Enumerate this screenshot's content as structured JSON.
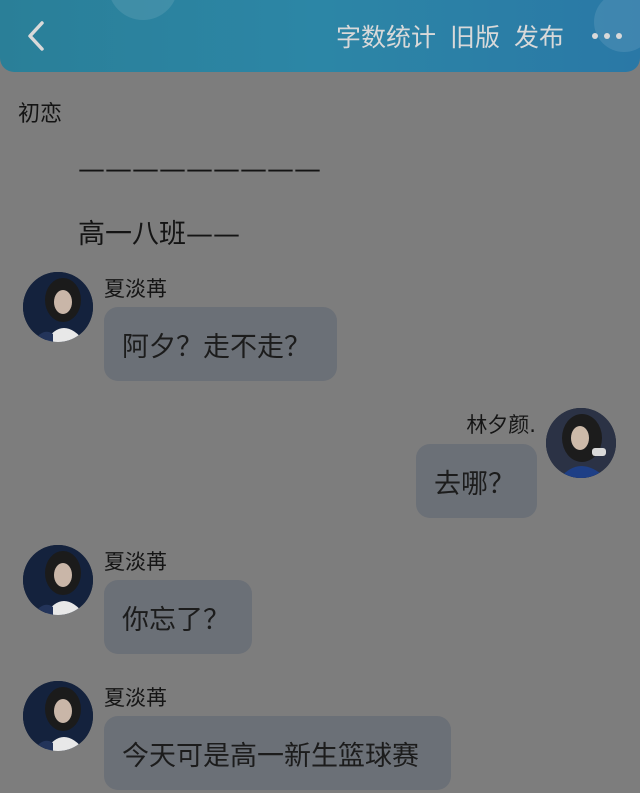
{
  "header": {
    "actions": [
      {
        "label": "字数统计"
      },
      {
        "label": "旧版"
      },
      {
        "label": "发布"
      }
    ],
    "icons": {
      "back": "chevron-left-icon",
      "more": "more-horizontal-icon"
    },
    "colors": {
      "header_bg": "#2a7f98",
      "page_bg": "#7d7d7d",
      "bubble_bg": "#6b7077"
    }
  },
  "chapter": {
    "title": "初恋"
  },
  "narration": [
    "—————————",
    "高一八班——"
  ],
  "messages": [
    {
      "sender": "夏淡苒",
      "text": "阿夕？走不走？",
      "side": "left"
    },
    {
      "sender": "林夕颜.",
      "text": "去哪？",
      "side": "right"
    },
    {
      "sender": "夏淡苒",
      "text": "你忘了？",
      "side": "left"
    },
    {
      "sender": "夏淡苒",
      "text": "今天可是高一新生篮球赛",
      "side": "left"
    }
  ]
}
